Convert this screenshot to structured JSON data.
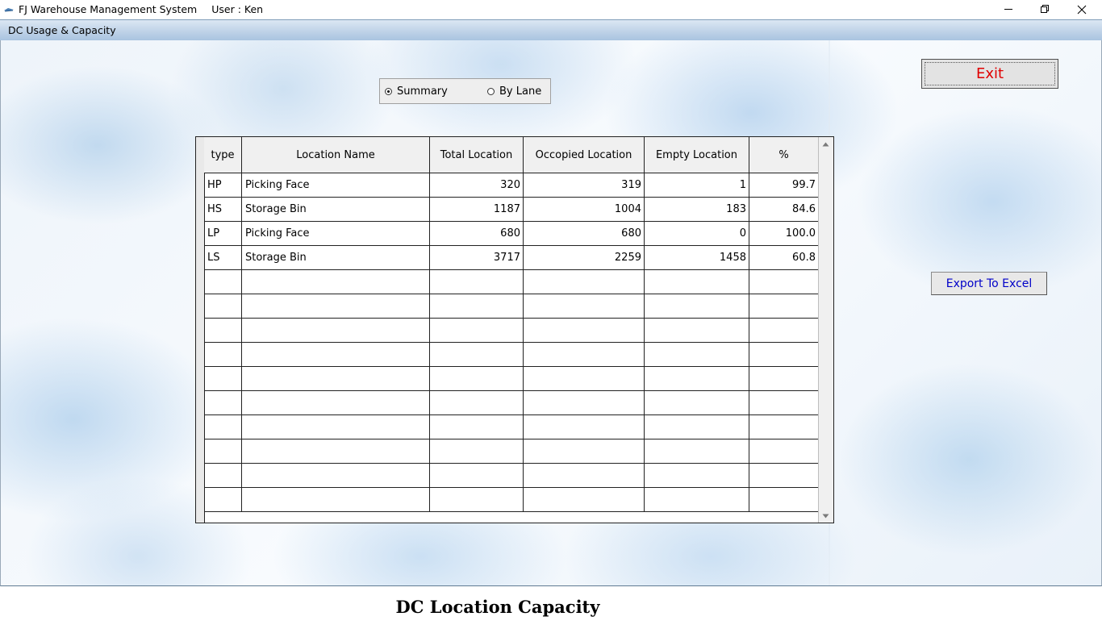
{
  "window": {
    "title": "FJ Warehouse Management System",
    "user": "User : Ken",
    "minimize_icon": "minimize-icon",
    "restore_icon": "restore-icon",
    "close_icon": "close-icon"
  },
  "form": {
    "title": "DC Usage & Capacity"
  },
  "view_options": {
    "options": [
      {
        "label": "Summary",
        "selected": true
      },
      {
        "label": "By Lane",
        "selected": false
      }
    ]
  },
  "buttons": {
    "exit": "Exit",
    "export": "Export To Excel"
  },
  "colors": {
    "exit_text": "#e00000",
    "export_text": "#0000c8"
  },
  "table": {
    "columns": [
      "type",
      "Location Name",
      "Total Location",
      "Occopied Location",
      "Empty Location",
      "%"
    ],
    "rows": [
      [
        "HP",
        "Picking Face",
        "320",
        "319",
        "1",
        "99.7"
      ],
      [
        "HS",
        "Storage Bin",
        "1187",
        "1004",
        "183",
        "84.6"
      ],
      [
        "LP",
        "Picking Face",
        "680",
        "680",
        "0",
        "100.0"
      ],
      [
        "LS",
        "Storage Bin",
        "3717",
        "2259",
        "1458",
        "60.8"
      ],
      [
        "",
        "",
        "",
        "",
        "",
        ""
      ],
      [
        "",
        "",
        "",
        "",
        "",
        ""
      ],
      [
        "",
        "",
        "",
        "",
        "",
        ""
      ],
      [
        "",
        "",
        "",
        "",
        "",
        ""
      ],
      [
        "",
        "",
        "",
        "",
        "",
        ""
      ],
      [
        "",
        "",
        "",
        "",
        "",
        ""
      ],
      [
        "",
        "",
        "",
        "",
        "",
        ""
      ],
      [
        "",
        "",
        "",
        "",
        "",
        ""
      ],
      [
        "",
        "",
        "",
        "",
        "",
        ""
      ],
      [
        "",
        "",
        "",
        "",
        "",
        ""
      ]
    ]
  },
  "caption": "DC Location Capacity"
}
